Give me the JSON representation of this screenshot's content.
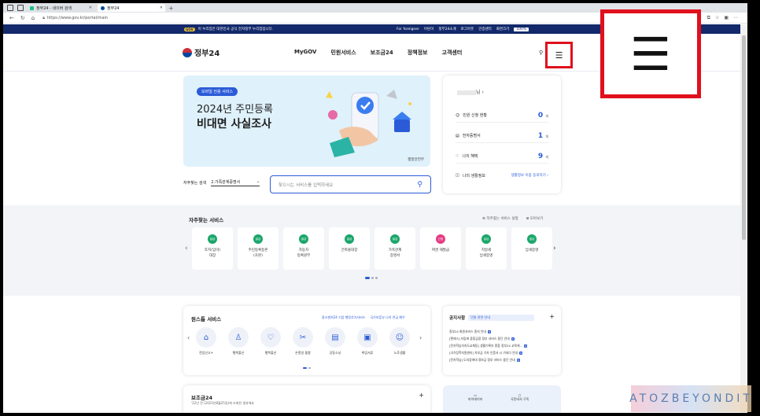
{
  "browser": {
    "tabs": [
      {
        "label": "정부24 - 네이버 검색",
        "active": false
      },
      {
        "label": "정부24",
        "active": true
      }
    ],
    "url": "https://www.gov.kr/portal/main",
    "new_tab_glyph": "+"
  },
  "govbar": {
    "logo": "GOV",
    "notice": "이 누리집은 대한민국 공식 전자정부 누리집입니다.",
    "links": [
      "For foreigner",
      "어린이",
      "정부24소개",
      "로그아웃",
      "인증센터",
      "화면크기"
    ],
    "zoom": "100%"
  },
  "header": {
    "logo_text": "정부24",
    "nav": [
      "MyGOV",
      "민원서비스",
      "보조금24",
      "정책정보",
      "고객센터"
    ],
    "menu_glyph": "☰"
  },
  "banner": {
    "pill": "모바일 전용 서비스",
    "line1": "2024년 주민등록",
    "line2": "비대면 사실조사",
    "brand": "행정안전부"
  },
  "quick_search": {
    "label": "자주찾는 검색",
    "selected": "2.가족관계증명서",
    "placeholder": "찾으시는 서비스를 입력하세요"
  },
  "profile": {
    "name_suffix": "님",
    "rows": [
      {
        "label": "민원 신청 현황",
        "value": "0",
        "unit": "개"
      },
      {
        "label": "전자증명서",
        "value": "1",
        "unit": "개"
      },
      {
        "label": "나의 혜택",
        "value": "9",
        "unit": "개"
      }
    ],
    "life_label": "나의 생활정보",
    "life_link": "생활정보 이용 동의하기"
  },
  "favorites": {
    "title": "자주찾는 서비스",
    "options": [
      "자주찾는 서비스 설정",
      "모아보기"
    ],
    "cards": [
      {
        "tag": "발급",
        "label": "토지(임야)\n대장",
        "color": "#1aa66a"
      },
      {
        "tag": "발급",
        "label": "주민등록등본\n(초본)",
        "color": "#1aa66a"
      },
      {
        "tag": "발급",
        "label": "자동차\n등록원부",
        "color": "#1aa66a"
      },
      {
        "tag": "발급",
        "label": "건축물대장",
        "color": "#1aa66a"
      },
      {
        "tag": "발급",
        "label": "가족관계\n증명서",
        "color": "#1aa66a"
      },
      {
        "tag": "신청",
        "label": "여권 재발급",
        "color": "#e63c84"
      },
      {
        "tag": "발급",
        "label": "지방세\n납세증명",
        "color": "#1aa66a"
      },
      {
        "tag": "발급",
        "label": "납세증명",
        "color": "#1aa66a"
      }
    ]
  },
  "onestop": {
    "title": "원스톱 서비스",
    "links": [
      "중소벤처24 기업 행정추가서비스",
      "국가보훈부 나의 연금 예우"
    ],
    "items": [
      {
        "icon": "⌂",
        "label": "전입신고+"
      },
      {
        "icon": "♙",
        "label": "행복출산"
      },
      {
        "icon": "♡",
        "label": "행복출산"
      },
      {
        "icon": "✂",
        "label": "온종일 돌봄"
      },
      {
        "icon": "▤",
        "label": "공동소닝"
      },
      {
        "icon": "▣",
        "label": "취업서류"
      },
      {
        "icon": "☺",
        "label": "노후생활"
      }
    ]
  },
  "notice": {
    "title": "공지사항",
    "tag": "민원 관련 안내",
    "items": [
      "정부24 회원서비스 중지 안내",
      "[편에스] 자립에 융합금융 정부 서비스 중단 안내",
      "[전자학습자지도교체등] 생활기록부 종합 정부24 교육에...",
      "[국가장학지원센터] 자부금 기자 인증서 시 가되다 안내",
      "[전자학습] 도지장애대 정보금 정부 서비스 중단 안내"
    ]
  },
  "subsidy": {
    "title": "보조금24",
    "sub": "'22년 전 (2023년8월25일)에 조회한 결과에요"
  },
  "mini": {
    "a": "마이데이터",
    "b": "국민비서 구독"
  },
  "zoom_glyph": "☰",
  "watermark": "ATOZBEYONDIT"
}
